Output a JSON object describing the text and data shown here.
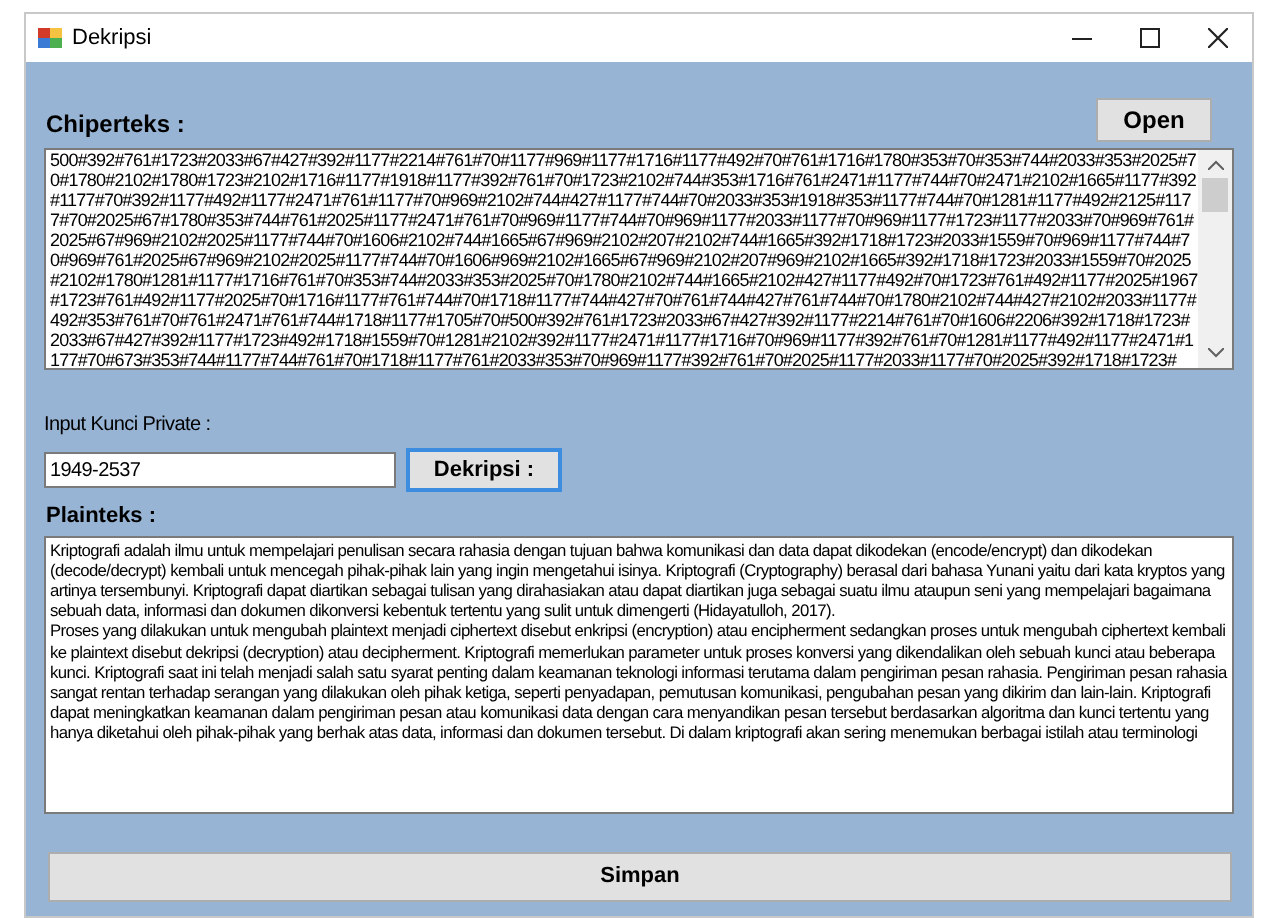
{
  "window": {
    "title": "Dekripsi"
  },
  "open_button": "Open",
  "ciphertext": {
    "label": "Chiperteks :",
    "value": "500#392#761#1723#2033#67#427#392#1177#2214#761#70#1177#969#1177#1716#1177#492#70#761#1716#1780#353#70#353#744#2033#353#2025#70#1780#2102#1780#1723#2102#1716#1177#1918#1177#392#761#70#1723#2102#744#353#1716#761#2471#1177#744#70#2471#2102#1665#1177#392#1177#70#392#1177#492#1177#2471#761#1177#70#969#2102#744#427#1177#744#70#2033#353#1918#353#1177#744#70#1281#1177#492#2125#1177#70#2025#67#1780#353#744#761#2025#1177#2471#761#70#969#1177#744#70#969#1177#2033#1177#70#969#1177#1723#1177#2033#70#969#761#2025#67#969#2102#2025#1177#744#70#1606#2102#744#1665#67#969#2102#207#2102#744#1665#392#1718#1723#2033#1559#70#969#1177#744#70#969#761#2025#67#969#2102#2025#1177#744#70#1606#969#2102#1665#67#969#2102#207#969#2102#1665#392#1718#1723#2033#1559#70#2025#2102#1780#1281#1177#1716#761#70#353#744#2033#353#2025#70#1780#2102#744#1665#2102#427#1177#492#70#1723#761#492#1177#2025#1967#1723#761#492#1177#2025#70#1716#1177#761#744#70#1718#1177#744#427#70#761#744#427#761#744#70#1780#2102#744#427#2102#2033#1177#492#353#761#70#761#2471#761#744#1718#1177#1705#70#500#392#761#1723#2033#67#427#392#1177#2214#761#70#1606#2206#392#1718#1723#2033#67#427#392#1177#1723#492#1718#1559#70#1281#2102#392#1177#2471#1177#1716#70#969#1177#392#761#70#1281#1177#492#1177#2471#1177#70#673#353#744#1177#744#761#70#1718#1177#761#2033#353#70#969#1177#392#761#70#2025#1177#2033#1177#70#2025#392#1718#1723#"
  },
  "key": {
    "label": "Input Kunci Private :",
    "value": "1949-2537"
  },
  "decrypt_button": "Dekripsi :",
  "plaintext": {
    "label": "Plainteks :",
    "value": "Kriptografi adalah ilmu untuk mempelajari penulisan secara rahasia dengan tujuan bahwa komunikasi dan data dapat dikodekan (encode/encrypt) dan dikodekan (decode/decrypt) kembali untuk mencegah pihak-pihak lain yang ingin mengetahui isinya. Kriptografi (Cryptography) berasal dari bahasa Yunani yaitu dari kata kryptos yang artinya tersembunyi. Kriptografi dapat diartikan sebagai tulisan yang dirahasiakan atau dapat diartikan juga sebagai suatu ilmu ataupun seni yang mempelajari bagaimana sebuah data, informasi dan dokumen dikonversi kebentuk tertentu yang sulit untuk dimengerti (Hidayatulloh, 2017).\nProses yang dilakukan untuk mengubah plaintext menjadi ciphertext disebut enkripsi (encryption) atau encipherment sedangkan proses untuk mengubah ciphertext kembali ke plaintext disebut dekripsi (decryption) atau decipherment. Kriptografi memerlukan parameter untuk proses konversi yang dikendalikan oleh sebuah kunci atau beberapa kunci. Kriptografi saat ini telah menjadi salah satu syarat penting dalam keamanan teknologi informasi terutama dalam pengiriman pesan rahasia. Pengiriman pesan rahasia sangat rentan terhadap serangan yang dilakukan oleh pihak ketiga, seperti penyadapan, pemutusan komunikasi, pengubahan pesan yang dikirim dan lain-lain. Kriptografi dapat meningkatkan keamanan dalam pengiriman pesan atau komunikasi data dengan cara menyandikan pesan tersebut berdasarkan algoritma dan kunci tertentu yang hanya diketahui oleh pihak-pihak yang berhak atas data, informasi dan dokumen tersebut. Di dalam kriptografi akan sering menemukan berbagai istilah atau terminologi"
  },
  "save_button": "Simpan"
}
